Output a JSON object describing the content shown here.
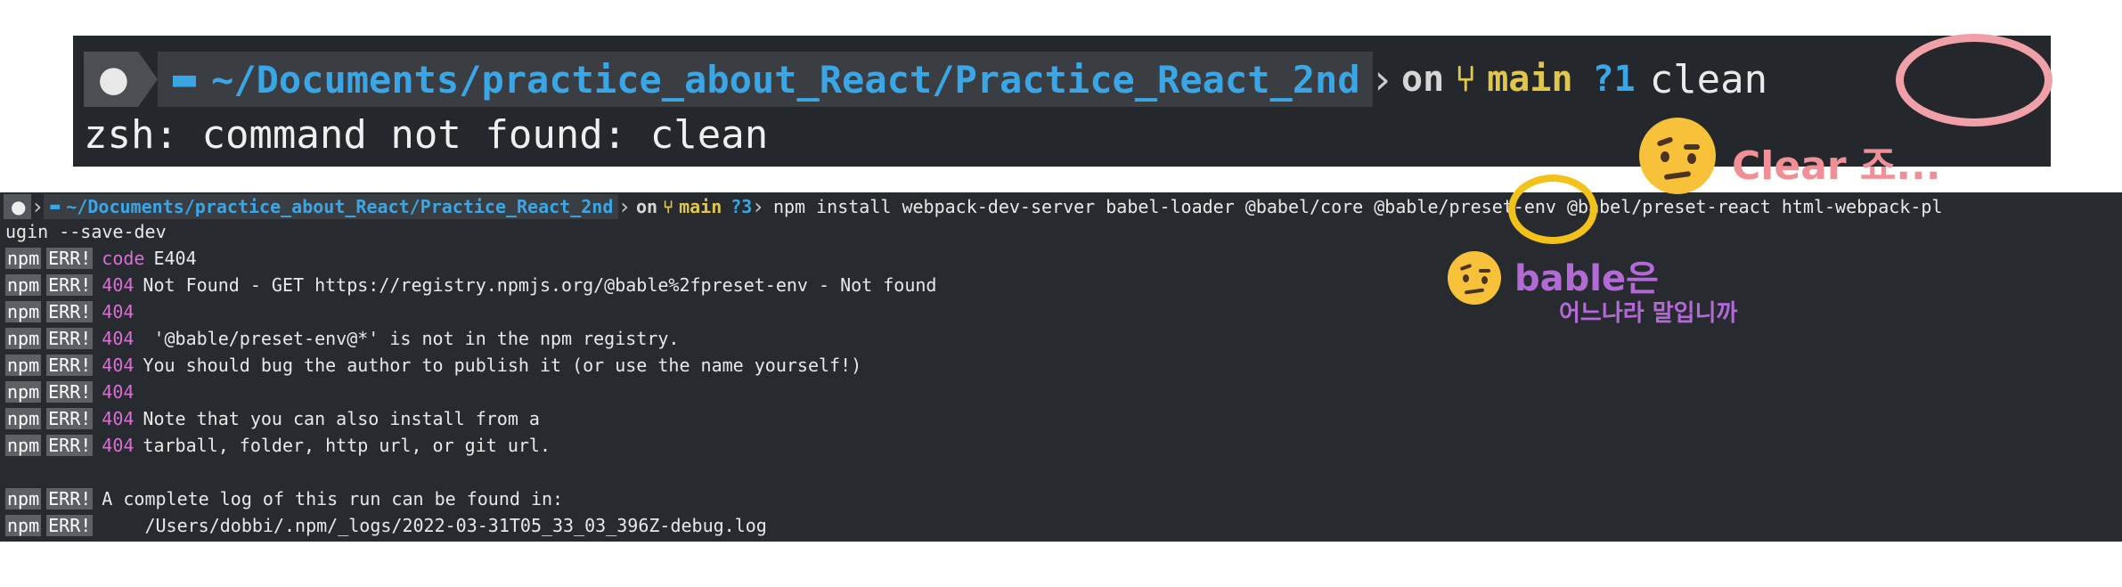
{
  "top_terminal": {
    "apple_glyph": "",
    "path": "~/Documents/practice_about_React/Practice_React_2nd",
    "on": "on",
    "branch": "main",
    "status": "?1",
    "command": "clean",
    "output": "zsh: command not found: clean"
  },
  "bottom_terminal": {
    "path": "~/Documents/practice_about_React/Practice_React_2nd",
    "on": "on",
    "branch": "main",
    "status": "?3",
    "command": "npm install webpack-dev-server babel-loader @babel/core @bable/preset-env @babel/preset-react html-webpack-pl",
    "command_continued": "ugin --save-dev",
    "log_lines": [
      {
        "prefix_npm": "npm",
        "prefix_err": "ERR!",
        "code_kw": "code",
        "text": "E404"
      },
      {
        "prefix_npm": "npm",
        "prefix_err": "ERR!",
        "num": "404",
        "text": "Not Found - GET https://registry.npmjs.org/@bable%2fpreset-env - Not found"
      },
      {
        "prefix_npm": "npm",
        "prefix_err": "ERR!",
        "num": "404",
        "text": ""
      },
      {
        "prefix_npm": "npm",
        "prefix_err": "ERR!",
        "num": "404",
        "text": " '@bable/preset-env@*' is not in the npm registry."
      },
      {
        "prefix_npm": "npm",
        "prefix_err": "ERR!",
        "num": "404",
        "text": "You should bug the author to publish it (or use the name yourself!)"
      },
      {
        "prefix_npm": "npm",
        "prefix_err": "ERR!",
        "num": "404",
        "text": ""
      },
      {
        "prefix_npm": "npm",
        "prefix_err": "ERR!",
        "num": "404",
        "text": "Note that you can also install from a"
      },
      {
        "prefix_npm": "npm",
        "prefix_err": "ERR!",
        "num": "404",
        "text": "tarball, folder, http url, or git url."
      },
      {
        "prefix_npm": "npm",
        "prefix_err": "ERR!",
        "text": "A complete log of this run can be found in:"
      },
      {
        "prefix_npm": "npm",
        "prefix_err": "ERR!",
        "text": "    /Users/dobbi/.npm/_logs/2022-03-31T05_33_03_396Z-debug.log"
      }
    ]
  },
  "annotations": {
    "clear_note": "Clear 죠...",
    "bable_note": "bable은",
    "korean_note": "어느나라 말입니까"
  },
  "colors": {
    "path_blue": "#3aa6e6",
    "git_yellow": "#e0c64a",
    "err_pink": "#d86fd3",
    "circle_pink": "#f0a0a6",
    "circle_yellow": "#f3c21a",
    "note_purple": "#b36ad6"
  }
}
